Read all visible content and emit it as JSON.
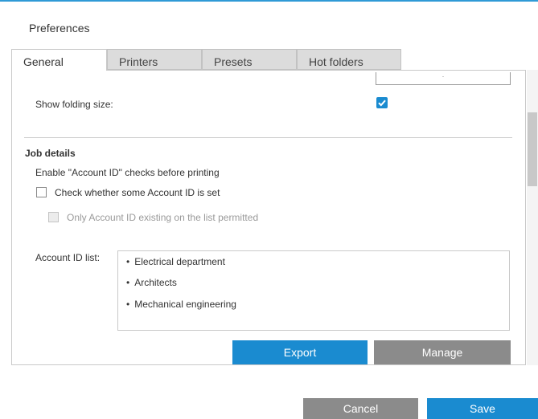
{
  "window": {
    "title": "Preferences"
  },
  "tabs": [
    {
      "label": "General",
      "active": true
    },
    {
      "label": "Printers",
      "active": false
    },
    {
      "label": "Presets",
      "active": false
    },
    {
      "label": "Hot folders",
      "active": false
    }
  ],
  "general": {
    "show_folding_size": {
      "label": "Show folding size:",
      "checked": true
    },
    "job_details": {
      "heading": "Job details",
      "account_id_checks_label": "Enable \"Account ID\" checks before printing",
      "check_account_id_set": {
        "label": "Check whether some Account ID is set",
        "checked": false
      },
      "only_existing_account_id": {
        "label": "Only Account ID existing on the list permitted",
        "checked": false,
        "enabled": false
      },
      "account_id_list": {
        "label": "Account ID list:",
        "items": [
          "Electrical department",
          "Architects",
          "Mechanical engineering"
        ]
      }
    },
    "buttons": {
      "export": "Export",
      "manage": "Manage"
    }
  },
  "footer": {
    "cancel": "Cancel",
    "save": "Save"
  },
  "colors": {
    "accent": "#1a8bd0",
    "secondary_button": "#8b8b8b",
    "top_rule": "#2f9ad6"
  }
}
